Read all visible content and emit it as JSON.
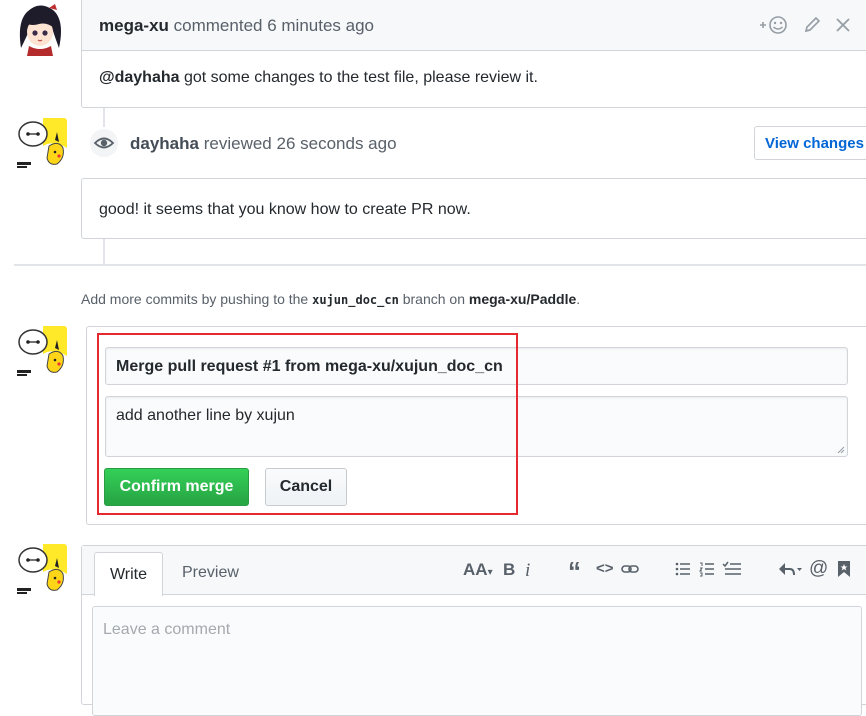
{
  "comment1": {
    "author": "mega-xu",
    "action": "commented",
    "time": "6 minutes ago",
    "mention": "@dayhaha",
    "body": "got some changes to the test file, please review it."
  },
  "review": {
    "author": "dayhaha",
    "action": "reviewed",
    "time": "26 seconds ago",
    "view_changes_label": "View changes",
    "body": "good! it seems that you know how to create PR now."
  },
  "add_commits": {
    "prefix": "Add more commits by pushing to the",
    "branch": "xujun_doc_cn",
    "middle": "branch on",
    "repo": "mega-xu/Paddle",
    "suffix": "."
  },
  "merge": {
    "title_value": "Merge pull request #1 from mega-xu/xujun_doc_cn",
    "message_value": "add another line by xujun",
    "confirm_label": "Confirm merge",
    "cancel_label": "Cancel"
  },
  "editor": {
    "tabs": [
      "Write",
      "Preview"
    ],
    "toolbar": {
      "text_size": "AA",
      "bold": "B",
      "italic": "i",
      "quote": "“",
      "code": "<>",
      "mention": "@"
    },
    "placeholder": "Leave a comment"
  },
  "icons": [
    "add-reaction-icon",
    "pencil-icon",
    "close-icon",
    "eye-icon",
    "link-icon",
    "bulleted-list-icon",
    "numbered-list-icon",
    "task-list-icon",
    "reply-icon",
    "bookmark-icon"
  ],
  "colors": {
    "link": "#0366d6",
    "merge_button": "#28a745",
    "annotation_box": "#e5292e"
  }
}
